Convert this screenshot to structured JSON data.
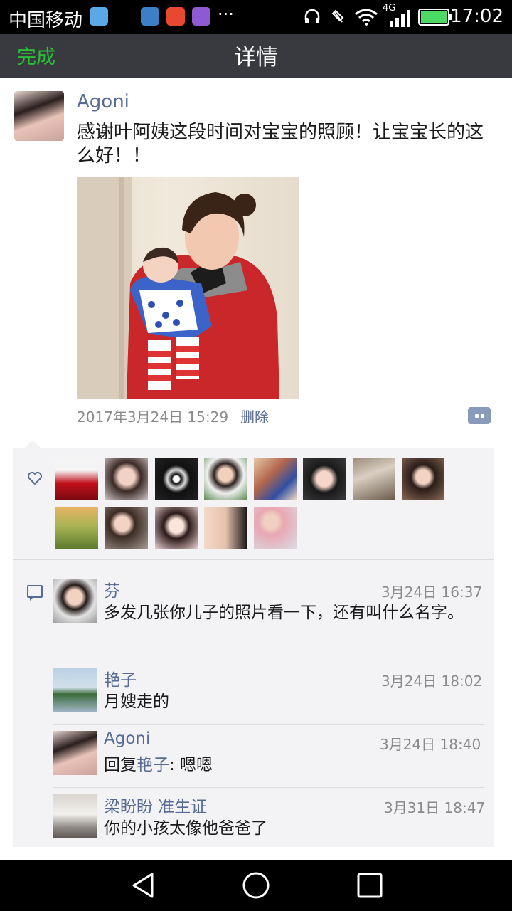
{
  "status_bar": {
    "carrier": "中国移动",
    "network": "4G",
    "time": "17:02"
  },
  "nav": {
    "done_label": "完成",
    "title": "详情"
  },
  "post": {
    "author": "Agoni",
    "text": "感谢叶阿姨这段时间对宝宝的照顾！让宝宝长的这么好！！",
    "timestamp": "2017年3月24日 15:29",
    "delete_label": "删除"
  },
  "comments": [
    {
      "name": "芬",
      "time": "3月24日 16:37",
      "text": "多发几张你儿子的照片看一下，还有叫什么名字。"
    },
    {
      "name": "艳子",
      "time": "3月24日 18:02",
      "text": "月嫂走的"
    },
    {
      "name": "Agoni",
      "time": "3月24日 18:40",
      "reply_prefix": "回复",
      "reply_to": "艳子",
      "reply_text": ": 嗯嗯"
    },
    {
      "name": "梁盼盼 准生证",
      "time": "3月31日 18:47",
      "text": "你的小孩太像他爸爸了"
    }
  ],
  "icons": [
    "back-icon",
    "home-icon",
    "recents-icon",
    "heart-icon",
    "comment-icon",
    "more-options-icon",
    "headphones-icon",
    "wifi-icon",
    "signal-icon",
    "battery-icon"
  ],
  "colors": {
    "link": "#576b95",
    "done": "#2bbd37",
    "nav_bg": "#393a3f"
  }
}
